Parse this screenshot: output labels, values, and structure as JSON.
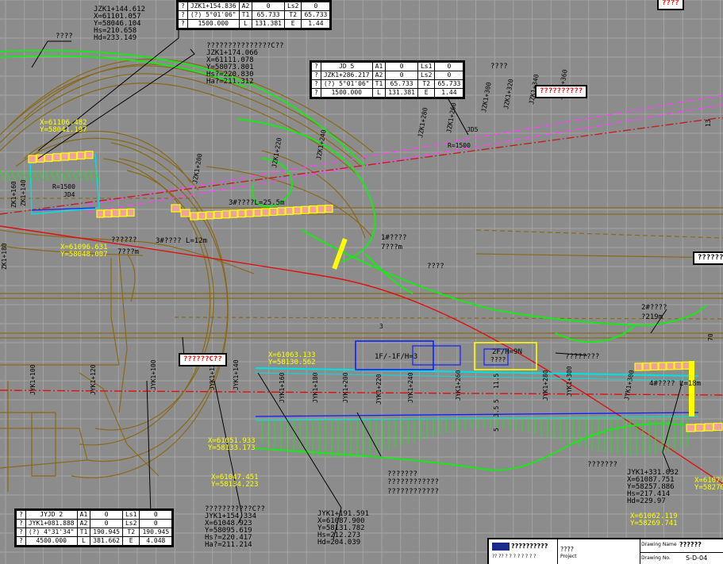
{
  "colors": {
    "background": "#8c8c8c",
    "grid": "#9e9e9e",
    "road": "#8a6a1a",
    "alignment_red": "#e01010",
    "magenta": "#ff40ff",
    "green": "#18e818",
    "cyan": "#00e0e0",
    "blue": "#1020ff",
    "yellow": "#ffff00",
    "black": "#000000",
    "white": "#ffffff"
  },
  "curve_tables": {
    "jzk_top": {
      "rows": [
        [
          "?",
          "JZK1+154.836",
          "A2",
          "0",
          "Ls2",
          "0"
        ],
        [
          "?",
          "(?) 5°01'06\"",
          "T1",
          "65.733",
          "T2",
          "65.733"
        ],
        [
          "?",
          "1500.000",
          "L",
          "131.381",
          "E",
          "1.44"
        ]
      ]
    },
    "jd5": {
      "rows": [
        [
          "?",
          "JD 5",
          "A1",
          "0",
          "Ls1",
          "0"
        ],
        [
          "?",
          "JZK1+286.217",
          "A2",
          "0",
          "Ls2",
          "0"
        ],
        [
          "?",
          "(?) 5°01'06\"",
          "T1",
          "65.733",
          "T2",
          "65.733"
        ],
        [
          "?",
          "1500.000",
          "L",
          "131.381",
          "E",
          "1.44"
        ]
      ]
    },
    "jyjd2": {
      "rows": [
        [
          "?",
          "JYJD 2",
          "A1",
          "0",
          "Ls1",
          "0"
        ],
        [
          "?",
          "JYK1+081.888",
          "A2",
          "0",
          "Ls2",
          "0"
        ],
        [
          "?",
          "(?) 4°31'34\"",
          "T1",
          "190.945",
          "T2",
          "190.945"
        ],
        [
          "?",
          "4500.000",
          "L",
          "381.662",
          "E",
          "4.048"
        ]
      ]
    }
  },
  "red_labels": {
    "top_right": "????",
    "mid_right": "??????????",
    "left_mid": "??????C??",
    "far_right": "????????"
  },
  "annotations": {
    "jzk_top": [
      "JZK1+144.612",
      "X=61101.057",
      "Y=58046.104",
      "Hs=210.658",
      "Hd=233.149"
    ],
    "jzk_mid": [
      "???????????????C??",
      "JZK1+174.066",
      "X=61111.078",
      "Y=58073.801",
      "Hs?=220.830",
      "Ha?=211.312"
    ],
    "jyk_bottom1": [
      "???????????C??",
      "JYK1+154.334",
      "X=61048.923",
      "Y=58095.619",
      "Hs?=220.417",
      "Ha?=211.214"
    ],
    "jyk_bottom2": [
      "JYK1+191.591",
      "X=61087.900",
      "Y=58131.782",
      "Hs=212.273",
      "Hd=204.039"
    ],
    "jyk_right": [
      "JYK1+331.032",
      "X=61087.751",
      "Y=58257.886",
      "Hs=217.414",
      "Hd=229.97"
    ],
    "q4_top": "????",
    "q4_mid": "????",
    "q6": "??????",
    "q8": "????????",
    "q12": "????????????",
    "q12b": "????????????",
    "q_s": "???????",
    "q_s2": "???????",
    "cn1": "3#???? L=12m",
    "cn2": "3#????L=25.5m",
    "cn3": "1#????",
    "cn4": "7???m",
    "cn5": "2#????",
    "cn6": "?219m",
    "cn7": "????",
    "cn8": "2F/H=9N",
    "cn9": "1F/-1F/H=3",
    "cn10": "????",
    "cn11": "4#???? L=18m",
    "jd_label": "JD5",
    "r_label": "R=1500",
    "r_left": "R=1500",
    "jd4": "JD4",
    "dims": [
      "11.5",
      "5",
      "3.5",
      "5"
    ],
    "num3": "3",
    "tb_right": "13",
    "rm_right": "70"
  },
  "yellow_coords": {
    "tl_top": [
      "X=61106.482",
      "Y=58041.197"
    ],
    "tl_bot": [
      "X=61096.631",
      "Y=58048.007"
    ],
    "mid": [
      "X=61063.133",
      "Y=58130.562"
    ],
    "b1": [
      "X=61051.933",
      "Y=58133.173"
    ],
    "b2": [
      "X=61047.451",
      "Y=58134.223"
    ],
    "br": [
      "X=61062.119",
      "Y=58269.741"
    ],
    "far": [
      "X=61077.",
      "Y=58270."
    ]
  },
  "stations": {
    "upper": [
      "JZK1+300",
      "JZK1+320",
      "JZK1+340",
      "JZK1+360"
    ],
    "upper_right": [
      "JZK1+260",
      "JZK1+280"
    ],
    "upper_left": [
      "JZK1+200",
      "JZK1+220",
      "JZK1+240"
    ],
    "left": [
      "ZK1+180",
      "ZK1+160",
      "ZK1+140"
    ],
    "lower": [
      "JYK1+100",
      "JYK1+120",
      "JYK1+140",
      "JYK1+160",
      "JYK1+180",
      "JYK1+200",
      "JYK1+220",
      "JYK1+240",
      "JYK1+260",
      "JYK1+280",
      "JYK1+300"
    ],
    "lower_left": [
      "JYK1+100",
      "JYK1+120"
    ],
    "right": [
      "JYK1+300"
    ]
  },
  "title_block": {
    "company": "??????????",
    "company_en": "?? ?? ? ? ? ? ? ? ? ?",
    "project_label": "????",
    "project_en": "Project",
    "drawing_name_label": "Drawing Name",
    "drawing_no_label": "Drawing No.",
    "drawing_name": "??????",
    "drawing_no": "S-D-04"
  }
}
